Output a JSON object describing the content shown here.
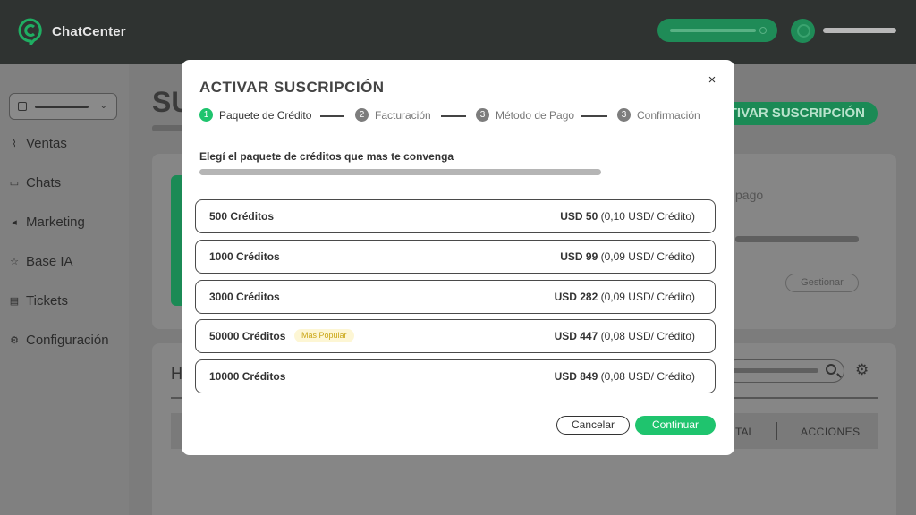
{
  "app": {
    "name": "ChatCenter",
    "accent_color": "#1fc46e"
  },
  "sidebar": {
    "items": [
      {
        "label": "Ventas",
        "icon": "chart-icon"
      },
      {
        "label": "Chats",
        "icon": "chat-icon"
      },
      {
        "label": "Marketing",
        "icon": "megaphone-icon"
      },
      {
        "label": "Base IA",
        "icon": "star-icon"
      },
      {
        "label": "Tickets",
        "icon": "ticket-icon"
      },
      {
        "label": "Configuración",
        "icon": "gear-icon"
      }
    ]
  },
  "background": {
    "title_fragment": "SU",
    "activate_button_fragment": "TIVAR SUSCRIPCIÓN",
    "card_text_fragment": "pago",
    "manage_button": "Gestionar",
    "history_heading_fragment": "H",
    "table_headers": [
      "TAL",
      "ACCIONES"
    ]
  },
  "modal": {
    "title": "ACTIVAR SUSCRIPCIÓN",
    "close_symbol": "×",
    "steps": [
      {
        "num": "1",
        "label": "Paquete de Crédito",
        "active": true
      },
      {
        "num": "2",
        "label": "Facturación",
        "active": false
      },
      {
        "num": "3",
        "label": "Método de Pago",
        "active": false
      },
      {
        "num": "3",
        "label": "Confirmación",
        "active": false
      }
    ],
    "subtitle": "Elegí el paquete de créditos que mas te convenga",
    "packages": [
      {
        "name": "500 Créditos",
        "price": "USD 50",
        "unit": "(0,10 USD/ Crédito)",
        "badge": ""
      },
      {
        "name": "1000 Créditos",
        "price": "USD 99",
        "unit": "(0,09 USD/ Crédito)",
        "badge": ""
      },
      {
        "name": "3000 Créditos",
        "price": "USD 282",
        "unit": "(0,09 USD/ Crédito)",
        "badge": ""
      },
      {
        "name": "50000 Créditos",
        "price": "USD 447",
        "unit": "(0,08 USD/ Crédito)",
        "badge": "Mas Popular"
      },
      {
        "name": "10000 Créditos",
        "price": "USD 849",
        "unit": "(0,08 USD/ Crédito)",
        "badge": ""
      }
    ],
    "cancel_label": "Cancelar",
    "continue_label": "Continuar"
  }
}
